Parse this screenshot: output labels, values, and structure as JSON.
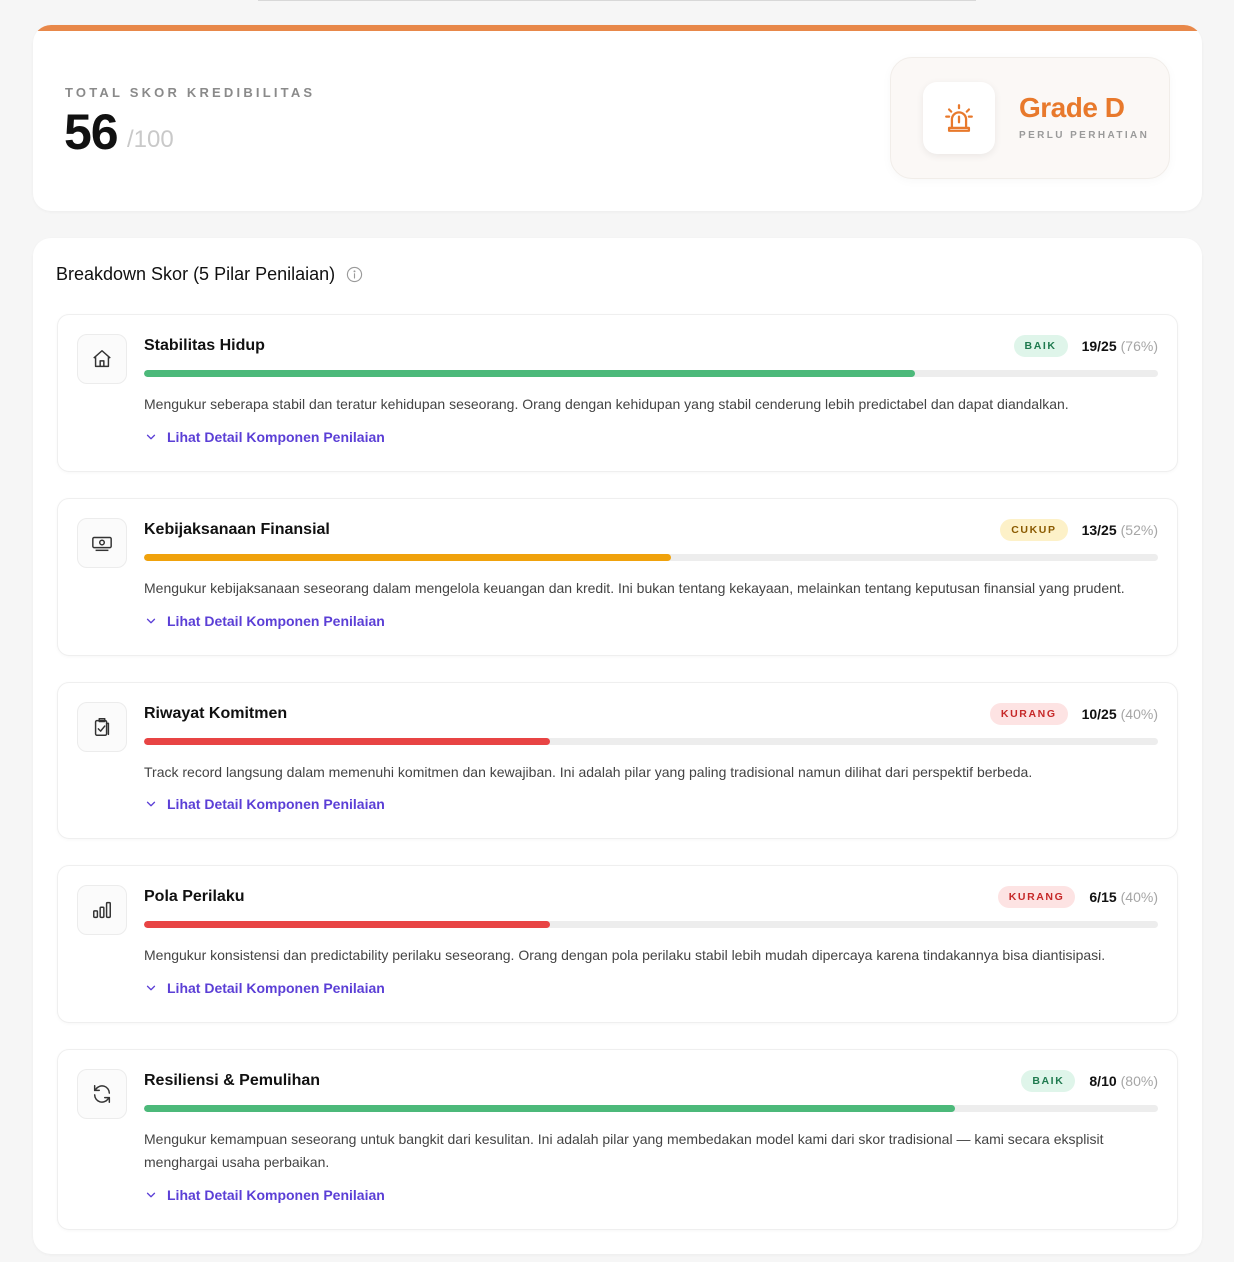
{
  "summary": {
    "label": "TOTAL SKOR KREDIBILITAS",
    "score": "56",
    "max": "/100",
    "grade": "Grade D",
    "grade_subtitle": "PERLU PERHATIAN",
    "grade_icon": "alert-bell-icon",
    "accent_color": "#e8884a"
  },
  "breakdown": {
    "title": "Breakdown Skor (5 Pilar Penilaian)",
    "info_icon": "info-icon",
    "pillars": [
      {
        "name": "Stabilitas Hidup",
        "icon": "home-icon",
        "badge": "BAIK",
        "status": "good",
        "score": "19/25",
        "percent_label": "(76%)",
        "progress": 0.76,
        "color": "#4cb97a",
        "description": "Mengukur seberapa stabil dan teratur kehidupan seseorang. Orang dengan kehidupan yang stabil cenderung lebih predictabel dan dapat diandalkan.",
        "link": "Lihat Detail Komponen Penilaian"
      },
      {
        "name": "Kebijaksanaan Finansial",
        "icon": "money-icon",
        "badge": "CUKUP",
        "status": "mid",
        "score": "13/25",
        "percent_label": "(52%)",
        "progress": 0.52,
        "color": "#f0a20c",
        "description": "Mengukur kebijaksanaan seseorang dalam mengelola keuangan dan kredit. Ini bukan tentang kekayaan, melainkan tentang keputusan finansial yang prudent.",
        "link": "Lihat Detail Komponen Penilaian"
      },
      {
        "name": "Riwayat Komitmen",
        "icon": "clipboard-check-icon",
        "badge": "KURANG",
        "status": "low",
        "score": "10/25",
        "percent_label": "(40%)",
        "progress": 0.4,
        "color": "#e84444",
        "description": "Track record langsung dalam memenuhi komitmen dan kewajiban. Ini adalah pilar yang paling tradisional namun dilihat dari perspektif berbeda.",
        "link": "Lihat Detail Komponen Penilaian"
      },
      {
        "name": "Pola Perilaku",
        "icon": "bar-chart-icon",
        "badge": "KURANG",
        "status": "low",
        "score": "6/15",
        "percent_label": "(40%)",
        "progress": 0.4,
        "color": "#e84444",
        "description": "Mengukur konsistensi dan predictability perilaku seseorang. Orang dengan pola perilaku stabil lebih mudah dipercaya karena tindakannya bisa diantisipasi.",
        "link": "Lihat Detail Komponen Penilaian"
      },
      {
        "name": "Resiliensi & Pemulihan",
        "icon": "refresh-icon",
        "badge": "BAIK",
        "status": "good",
        "score": "8/10",
        "percent_label": "(80%)",
        "progress": 0.8,
        "color": "#4cb97a",
        "description": "Mengukur kemampuan seseorang untuk bangkit dari kesulitan. Ini adalah pilar yang membedakan model kami dari skor tradisional — kami secara eksplisit menghargai usaha perbaikan.",
        "link": "Lihat Detail Komponen Penilaian"
      }
    ]
  }
}
